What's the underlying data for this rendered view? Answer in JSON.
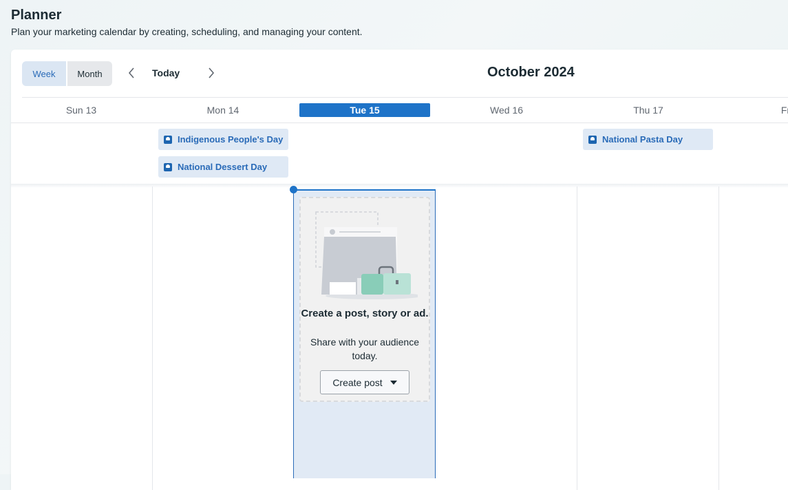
{
  "page": {
    "title": "Planner",
    "subtitle": "Plan your marketing calendar by creating, scheduling, and managing your content."
  },
  "toolbar": {
    "views": [
      "Week",
      "Month"
    ],
    "selected_view": "Week",
    "today_label": "Today",
    "month_label": "October 2024",
    "icons": {
      "prev": "chevron-left-icon",
      "next": "chevron-right-icon"
    }
  },
  "days": [
    {
      "label": "Sun 13"
    },
    {
      "label": "Mon 14"
    },
    {
      "label": "Tue 15",
      "today": true
    },
    {
      "label": "Wed 16"
    },
    {
      "label": "Thu 17"
    },
    {
      "label": "Fri"
    }
  ],
  "events": [
    {
      "day": "Mon 14",
      "label": "Indigenous People's Day",
      "icon": "calendar-event-icon"
    },
    {
      "day": "Mon 14",
      "label": "National Dessert Day",
      "icon": "calendar-event-icon"
    },
    {
      "day": "Thu 17",
      "label": "National Pasta Day",
      "icon": "calendar-event-icon"
    }
  ],
  "empty_state": {
    "title": "Create a post, story or ad.",
    "text": "Share with your audience today.",
    "button_label": "Create post"
  },
  "colors": {
    "accent": "#1e73c8",
    "event_bg": "#dfe9f5",
    "event_text": "#2a6bb8",
    "today_col_bg": "#e1eaf5"
  }
}
